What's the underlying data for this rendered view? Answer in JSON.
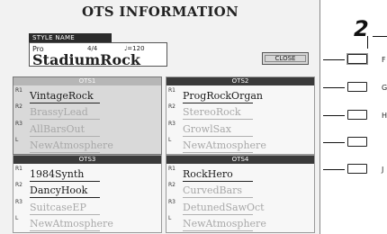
{
  "title": "OTS INFORMATION",
  "style": {
    "tag": "STYLE NAME",
    "category": "Pro",
    "beat": "4/4",
    "tempo": "♩=120",
    "name": "StadiumRock"
  },
  "close_label": "CLOSE",
  "callout_number": "2",
  "panels": [
    {
      "label": "OTS1",
      "parts": [
        {
          "tag": "R1",
          "voice": "VintageRock",
          "state": "on"
        },
        {
          "tag": "R2",
          "voice": "BrassyLead",
          "state": "off"
        },
        {
          "tag": "R3",
          "voice": "AllBarsOut",
          "state": "off"
        },
        {
          "tag": "L",
          "voice": "NewAtmosphere",
          "state": "off"
        }
      ]
    },
    {
      "label": "OTS2",
      "parts": [
        {
          "tag": "R1",
          "voice": "ProgRockOrgan",
          "state": "on"
        },
        {
          "tag": "R2",
          "voice": "StereoRock",
          "state": "off"
        },
        {
          "tag": "R3",
          "voice": "GrowlSax",
          "state": "off"
        },
        {
          "tag": "L",
          "voice": "NewAtmosphere",
          "state": "off"
        }
      ]
    },
    {
      "label": "OTS3",
      "parts": [
        {
          "tag": "R1",
          "voice": "1984Synth",
          "state": "on"
        },
        {
          "tag": "R2",
          "voice": "DancyHook",
          "state": "on"
        },
        {
          "tag": "R3",
          "voice": "SuitcaseEP",
          "state": "off"
        },
        {
          "tag": "L",
          "voice": "NewAtmosphere",
          "state": "off"
        }
      ]
    },
    {
      "label": "OTS4",
      "parts": [
        {
          "tag": "R1",
          "voice": "RockHero",
          "state": "on"
        },
        {
          "tag": "R2",
          "voice": "CurvedBars",
          "state": "off"
        },
        {
          "tag": "R3",
          "voice": "DetunedSawOct",
          "state": "off"
        },
        {
          "tag": "L",
          "voice": "NewAtmosphere",
          "state": "off"
        }
      ]
    }
  ],
  "hardware_button_letters": [
    "F",
    "G",
    "H",
    "",
    "J"
  ]
}
